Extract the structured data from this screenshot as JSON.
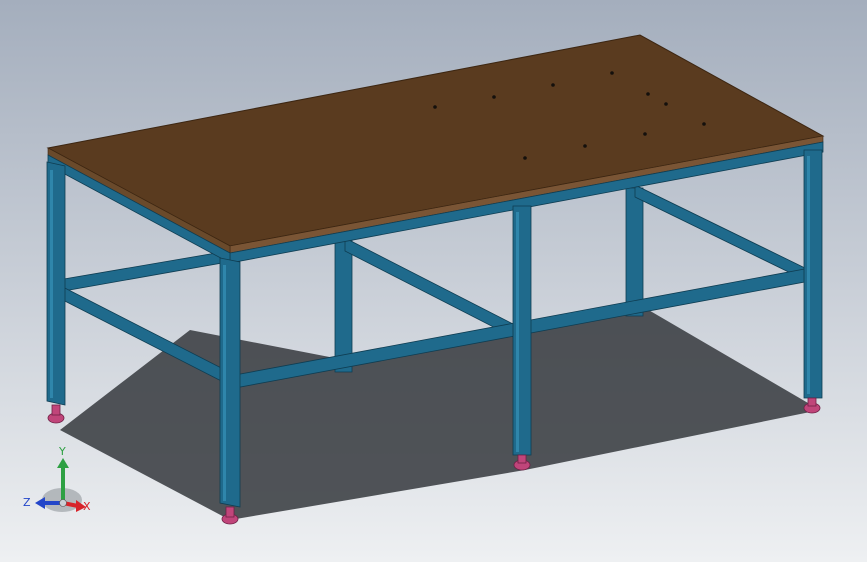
{
  "viewport": {
    "background_top": "#a4aebd",
    "background_bottom": "#eef0f2"
  },
  "model": {
    "part": "workbench",
    "frame_color": "#1f6a8c",
    "frame_dark": "#14506b",
    "top_color": "#5a3b1f",
    "top_edge": "#7a5535",
    "foot_color": "#c0457a",
    "shadow_color": "#3a3d42"
  },
  "triad": {
    "x_label": "X",
    "y_label": "Y",
    "z_label": "Z",
    "x_color": "#d8232a",
    "y_color": "#2ea043",
    "z_color": "#2346c9"
  }
}
